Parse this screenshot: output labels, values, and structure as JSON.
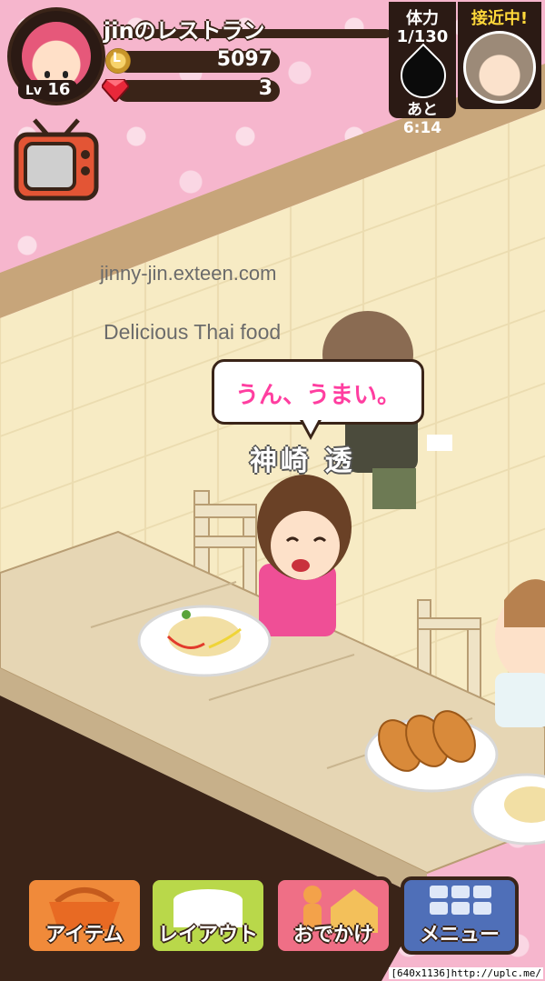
{
  "hud": {
    "restaurant_name": "jinのレストラン",
    "level_prefix": "Lv",
    "level": "16",
    "coins": "5097",
    "gems": "3",
    "coin_symbol": "L",
    "stamina_label": "体力",
    "stamina_value": "1/130",
    "stamina_timer": "あと6:14",
    "approach_label": "接近中!"
  },
  "watermark": {
    "site": "jinny-jin.exteen.com",
    "caption": "Delicious Thai food"
  },
  "speech": {
    "text": "うん、うまい。",
    "speaker": "神崎 透"
  },
  "menu": {
    "items": [
      {
        "label": "アイテム",
        "color": "#f08a3a"
      },
      {
        "label": "レイアウト",
        "color": "#b9d84a"
      },
      {
        "label": "おでかけ",
        "color": "#ef6f86"
      },
      {
        "label": "メニュー",
        "color": "#4f6fb8"
      }
    ]
  },
  "credit": "[640x1136]http://uplc.me/"
}
